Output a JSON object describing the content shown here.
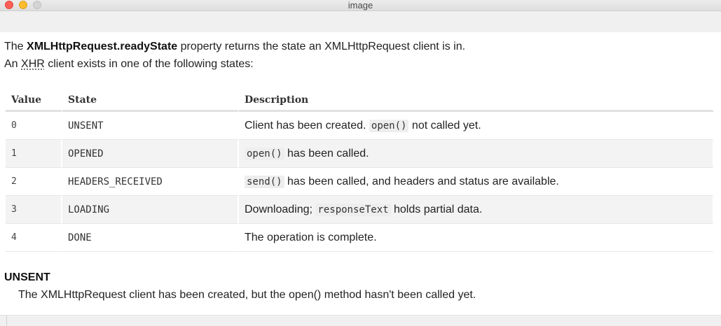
{
  "window": {
    "title": "image"
  },
  "intro": {
    "line1_prefix": "The ",
    "line1_bold": "XMLHttpRequest.readyState",
    "line1_suffix": " property returns the state an XMLHttpRequest client is in.",
    "line2_prefix": "An ",
    "line2_abbr": "XHR",
    "line2_suffix": " client exists in one of the following states:"
  },
  "table": {
    "headers": [
      "Value",
      "State",
      "Description"
    ],
    "rows": [
      {
        "value": "0",
        "state": "UNSENT",
        "desc_pre": "Client has been created. ",
        "desc_code": "open()",
        "desc_post": " not called yet."
      },
      {
        "value": "1",
        "state": "OPENED",
        "desc_pre": "",
        "desc_code": "open()",
        "desc_post": " has been called."
      },
      {
        "value": "2",
        "state": "HEADERS_RECEIVED",
        "desc_pre": "",
        "desc_code": "send()",
        "desc_post": " has been called, and headers and status are available."
      },
      {
        "value": "3",
        "state": "LOADING",
        "desc_pre": "Downloading; ",
        "desc_code": "responseText",
        "desc_post": " holds partial data."
      },
      {
        "value": "4",
        "state": "DONE",
        "desc_pre": "The operation is complete.",
        "desc_code": "",
        "desc_post": ""
      }
    ]
  },
  "section": {
    "title": "UNSENT",
    "body": "The XMLHttpRequest client has been created, but the open() method hasn't been called yet."
  },
  "icons": [
    "close-button",
    "minimize-button",
    "zoom-button"
  ]
}
